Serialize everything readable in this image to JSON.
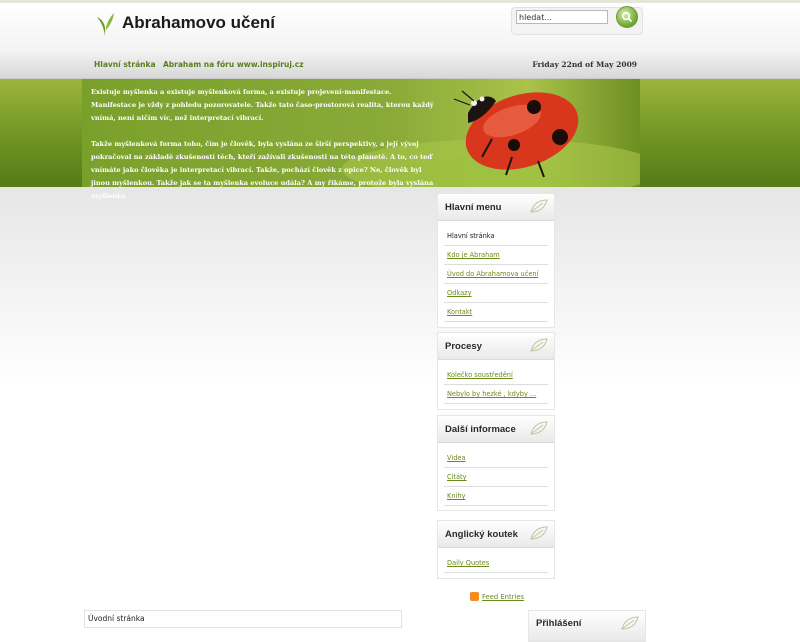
{
  "header": {
    "site_title": "Abrahamovo učení",
    "search_placeholder": "hledat..."
  },
  "nav": {
    "items": [
      "Hlavní stránka",
      "Abraham na fóru www.inspiruj.cz"
    ],
    "date": "Friday 22nd of May 2009"
  },
  "intro": {
    "paragraphs": [
      "Existuje myšlenka a existuje myšlenková forma, a existuje projevení-manifestace. Manifestace je vždy z pohledu pozorovatele. Takže tato časo-prostorová realita, kterou každý vnímá, není ničím víc, než interpretací vibrací.",
      "Takže myšlenková forma toho, čím je člověk, byla vyslána ze širší perspektivy, a její vývoj pokračoval na základě zkušeností těch, kteří zažívali zkušenosti na této planetě. A to, co teď vnímáte jako člověka je interpretací vibrací. Takže, pochází člověk z opice? Ne, člověk byl jinou myšlenkou. Takže jak se ta myšlenka evoluce udála? A my říkáme, protože byla vyslána myšlenka"
    ]
  },
  "sidebar": {
    "menu": {
      "title": "Hlavní menu",
      "items": [
        "Hlavní stránka",
        "Kdo je Abraham",
        "Úvod do Abrahamova učení",
        "Odkazy",
        "Kontakt"
      ]
    },
    "procesy": {
      "title": "Procesy",
      "items": [
        "Kolečko soustředění",
        "Nebylo by hezké , kdyby ..."
      ]
    },
    "dalsi": {
      "title": "Další informace",
      "items": [
        "Videa",
        "Citáty",
        "Knihy"
      ]
    },
    "anglicky": {
      "title": "Anglický koutek",
      "items": [
        "Daily Quotes"
      ]
    },
    "feed": "Feed Entries",
    "login_title": "Přihlášení"
  },
  "breadcrumb": "Úvodní stránka",
  "colors": {
    "accent_green": "#6d8a1e",
    "hero_green": "#7aa02c",
    "ladybug_red": "#d9361e"
  }
}
